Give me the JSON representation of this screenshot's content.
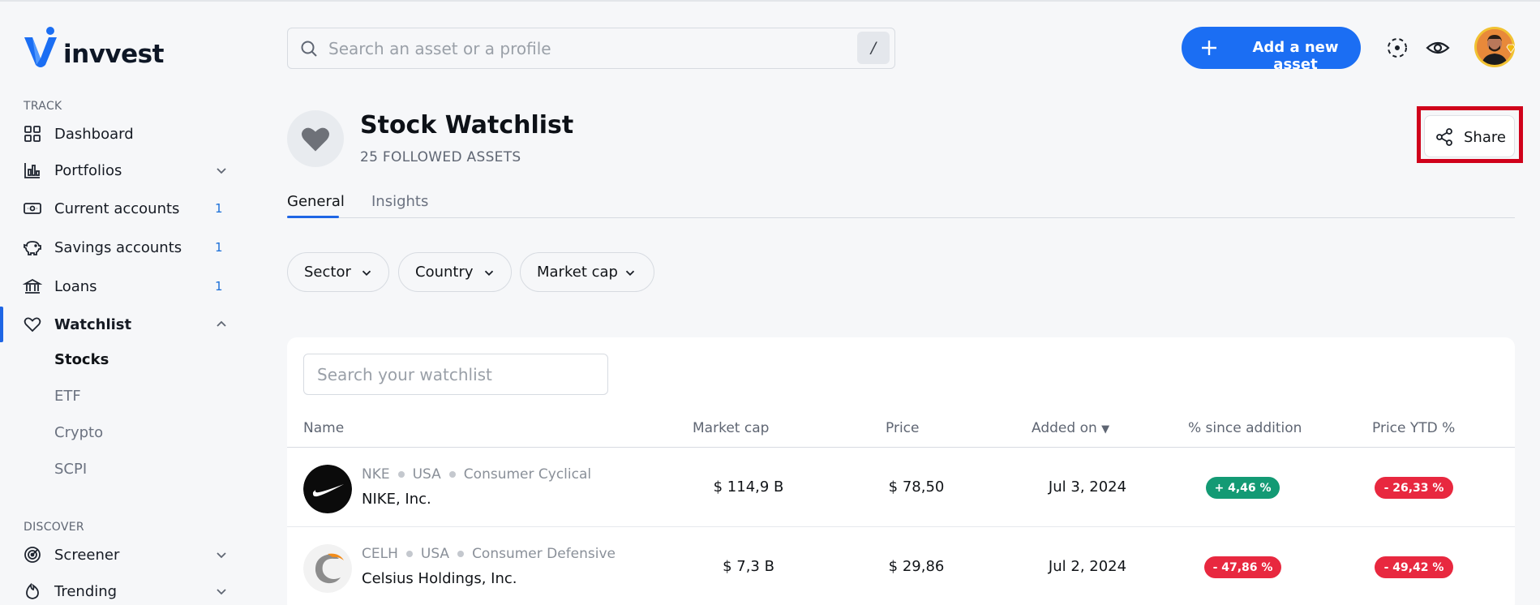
{
  "app": {
    "name": "invvest"
  },
  "sidebar": {
    "track_label": "TRACK",
    "discover_label": "DISCOVER",
    "items": [
      {
        "label": "Dashboard"
      },
      {
        "label": "Portfolios"
      },
      {
        "label": "Current accounts",
        "badge": "1"
      },
      {
        "label": "Savings accounts",
        "badge": "1"
      },
      {
        "label": "Loans",
        "badge": "1"
      },
      {
        "label": "Watchlist"
      }
    ],
    "watchlist_sub": [
      "Stocks",
      "ETF",
      "Crypto",
      "SCPI"
    ],
    "discover_items": [
      {
        "label": "Screener"
      },
      {
        "label": "Trending"
      }
    ]
  },
  "header": {
    "search_placeholder": "Search an asset or a profile",
    "search_shortcut": "/",
    "add_asset_label": "Add a new asset"
  },
  "page": {
    "title": "Stock Watchlist",
    "subtitle": "25 FOLLOWED ASSETS",
    "share_label": "Share",
    "tabs": [
      "General",
      "Insights"
    ],
    "filters": [
      "Sector",
      "Country",
      "Market cap"
    ]
  },
  "table": {
    "search_placeholder": "Search your watchlist",
    "columns": [
      "Name",
      "Market cap",
      "Price",
      "Added on",
      "% since addition",
      "Price YTD %"
    ],
    "rows": [
      {
        "ticker": "NKE",
        "country": "USA",
        "sector": "Consumer Cyclical",
        "name": "NIKE, Inc.",
        "market_cap": "$ 114,9 B",
        "price": "$ 78,50",
        "added_on": "Jul 3, 2024",
        "since_addition": "+ 4,46 %",
        "ytd": "- 26,33 %"
      },
      {
        "ticker": "CELH",
        "country": "USA",
        "sector": "Consumer Defensive",
        "name": "Celsius Holdings, Inc.",
        "market_cap": "$ 7,3 B",
        "price": "$ 29,86",
        "added_on": "Jul 2, 2024",
        "since_addition": "- 47,86 %",
        "ytd": "- 49,42 %"
      }
    ]
  },
  "colors": {
    "accent": "#1b6ef3",
    "positive": "#139a74",
    "negative": "#e8283f",
    "highlight": "#d0021b"
  }
}
